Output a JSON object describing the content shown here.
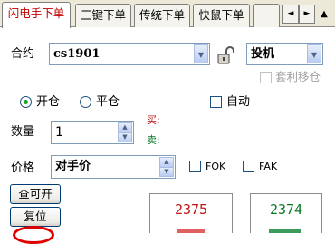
{
  "tabs": [
    {
      "label": "闪电手下单",
      "active": true
    },
    {
      "label": "三键下单",
      "active": false
    },
    {
      "label": "传统下单",
      "active": false
    },
    {
      "label": "快鼠下单",
      "active": false
    },
    {
      "label": "",
      "active": false
    }
  ],
  "tab_nav": {
    "left_icon": "◄",
    "right_icon": "►",
    "eject_icon": "▲"
  },
  "contract": {
    "label": "合约",
    "value": "cs1901"
  },
  "hedge": {
    "value": "投机"
  },
  "arbitrage_move": {
    "label": "套利移仓",
    "checked": false
  },
  "open_close": {
    "open_label": "开仓",
    "close_label": "平仓",
    "selected": "open"
  },
  "auto": {
    "label": "自动",
    "checked": false
  },
  "quantity": {
    "label": "数量",
    "value": "1"
  },
  "quote_labels": {
    "buy": "买:",
    "sell": "卖:"
  },
  "price": {
    "label": "价格",
    "value": "对手价"
  },
  "fok": {
    "label": "FOK",
    "checked": false
  },
  "fak": {
    "label": "FAK",
    "checked": false
  },
  "buttons": {
    "query_open": "查可开",
    "reset": "复位"
  },
  "prices": {
    "buy": "2375",
    "sell": "2374"
  },
  "colors": {
    "buy": "#c01818",
    "sell": "#0a7a28",
    "active_tab_text": "#c00000"
  }
}
